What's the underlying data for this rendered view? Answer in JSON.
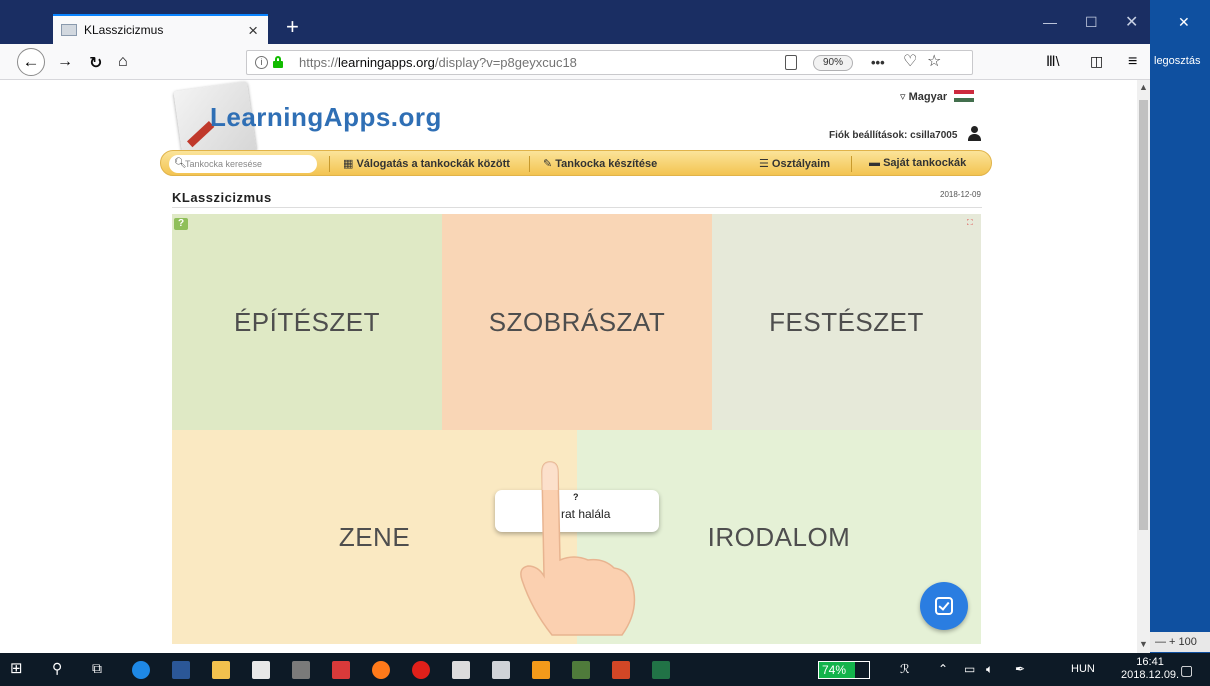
{
  "browser": {
    "tab_title": "KLasszicizmus",
    "url_prefix": "https://",
    "url_domain": "learningapps.org",
    "url_path": "/display?v=p8geyxcuc18",
    "zoom": "90%",
    "more_menu": "•••",
    "side_text": "legosztás",
    "side_zoom": "— + 100"
  },
  "site": {
    "logo": "LearningApps.org",
    "language": "Magyar",
    "account_label": "Fiók beállítások: csilla7005",
    "search_placeholder": "Tankocka keresése",
    "nav": [
      "Válogatás a tankockák között",
      "Tankocka készítése",
      "Osztályaim",
      "Saját tankockák"
    ]
  },
  "app": {
    "title": "KLasszicizmus",
    "date": "2018-12-09",
    "categories": [
      "ÉPÍTÉSZET",
      "SZOBRÁSZAT",
      "FESTÉSZET",
      "ZENE",
      "IRODALOM"
    ],
    "card_marker": "?",
    "card_text": "rat halála"
  },
  "taskbar": {
    "battery": "74%",
    "language": "HUN",
    "time": "16:41",
    "date": "2018.12.09."
  },
  "colors": {
    "titlebar": "#1a2e63",
    "accent_blue": "#2a7de1",
    "nav_gold": "#f3c451"
  }
}
